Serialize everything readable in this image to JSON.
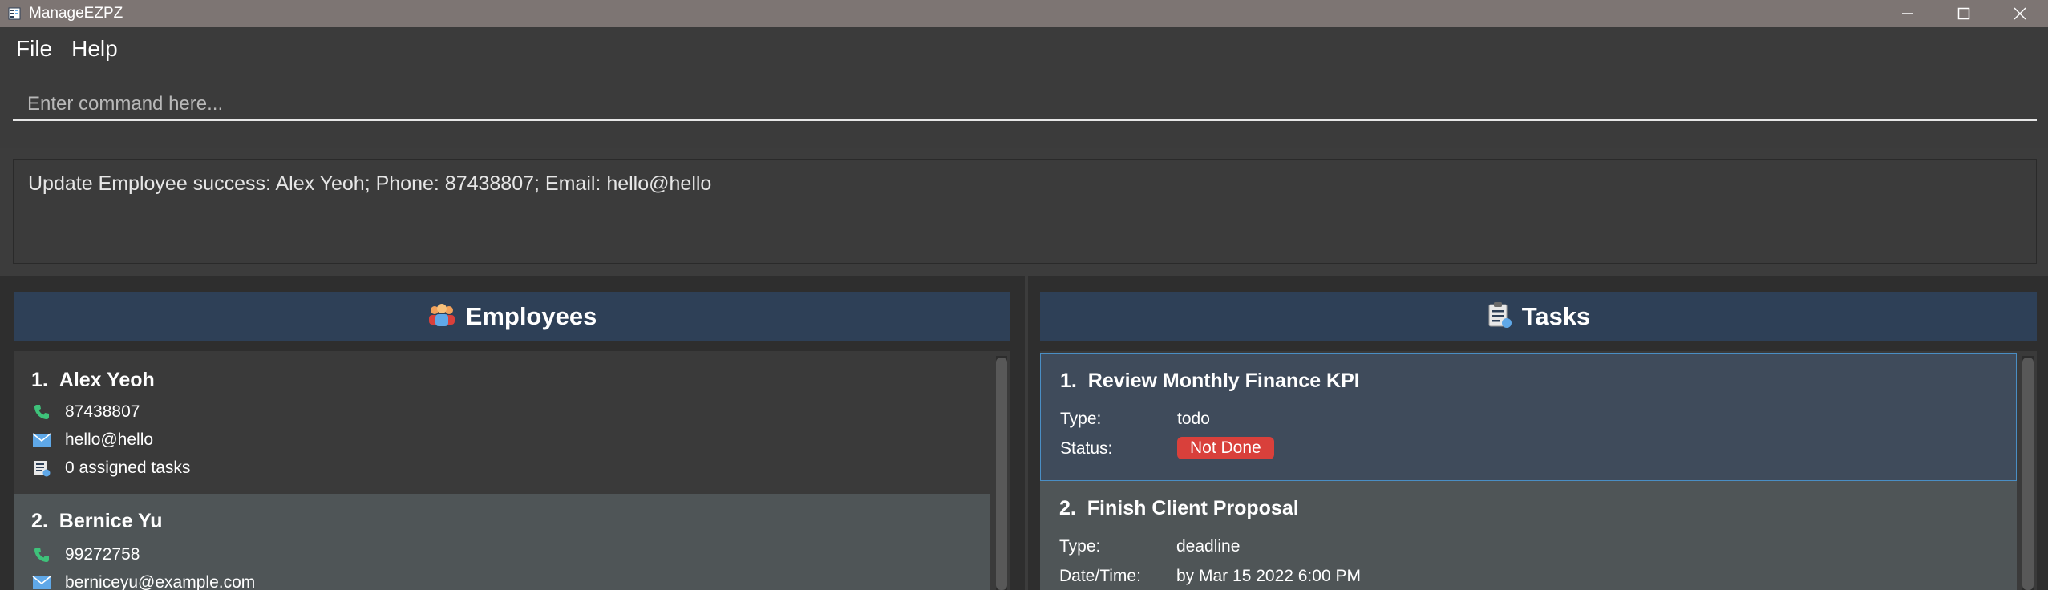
{
  "window": {
    "title": "ManageEZPZ"
  },
  "menu": {
    "file": "File",
    "help": "Help"
  },
  "command": {
    "placeholder": "Enter command here...",
    "value": ""
  },
  "result": {
    "text": "Update Employee success: Alex Yeoh; Phone: 87438807; Email: hello@hello"
  },
  "employees_panel": {
    "title": "Employees",
    "items": [
      {
        "index": "1.",
        "name": "Alex Yeoh",
        "phone": "87438807",
        "email": "hello@hello",
        "tasks": "0 assigned tasks"
      },
      {
        "index": "2.",
        "name": "Bernice Yu",
        "phone": "99272758",
        "email": "berniceyu@example.com"
      }
    ]
  },
  "tasks_panel": {
    "title": "Tasks",
    "items": [
      {
        "index": "1.",
        "name": "Review Monthly Finance KPI",
        "type_label": "Type:",
        "type": "todo",
        "status_label": "Status:",
        "status": "Not Done"
      },
      {
        "index": "2.",
        "name": "Finish Client Proposal",
        "type_label": "Type:",
        "type": "deadline",
        "datetime_label": "Date/Time:",
        "datetime": "by Mar 15 2022 6:00 PM"
      }
    ]
  },
  "colors": {
    "titlebar": "#7d7573",
    "panel_header": "#2e4057",
    "selected_card": "#3f4b5b",
    "alt_card": "#4f5557",
    "status_not_done": "#d9403b",
    "phone_icon": "#3ec27a",
    "email_icon": "#5fa8e8"
  },
  "icons": {
    "phone": "phone-icon",
    "email": "mail-icon",
    "tasks": "task-list-icon",
    "employees": "people-icon",
    "task_header": "clipboard-icon"
  }
}
